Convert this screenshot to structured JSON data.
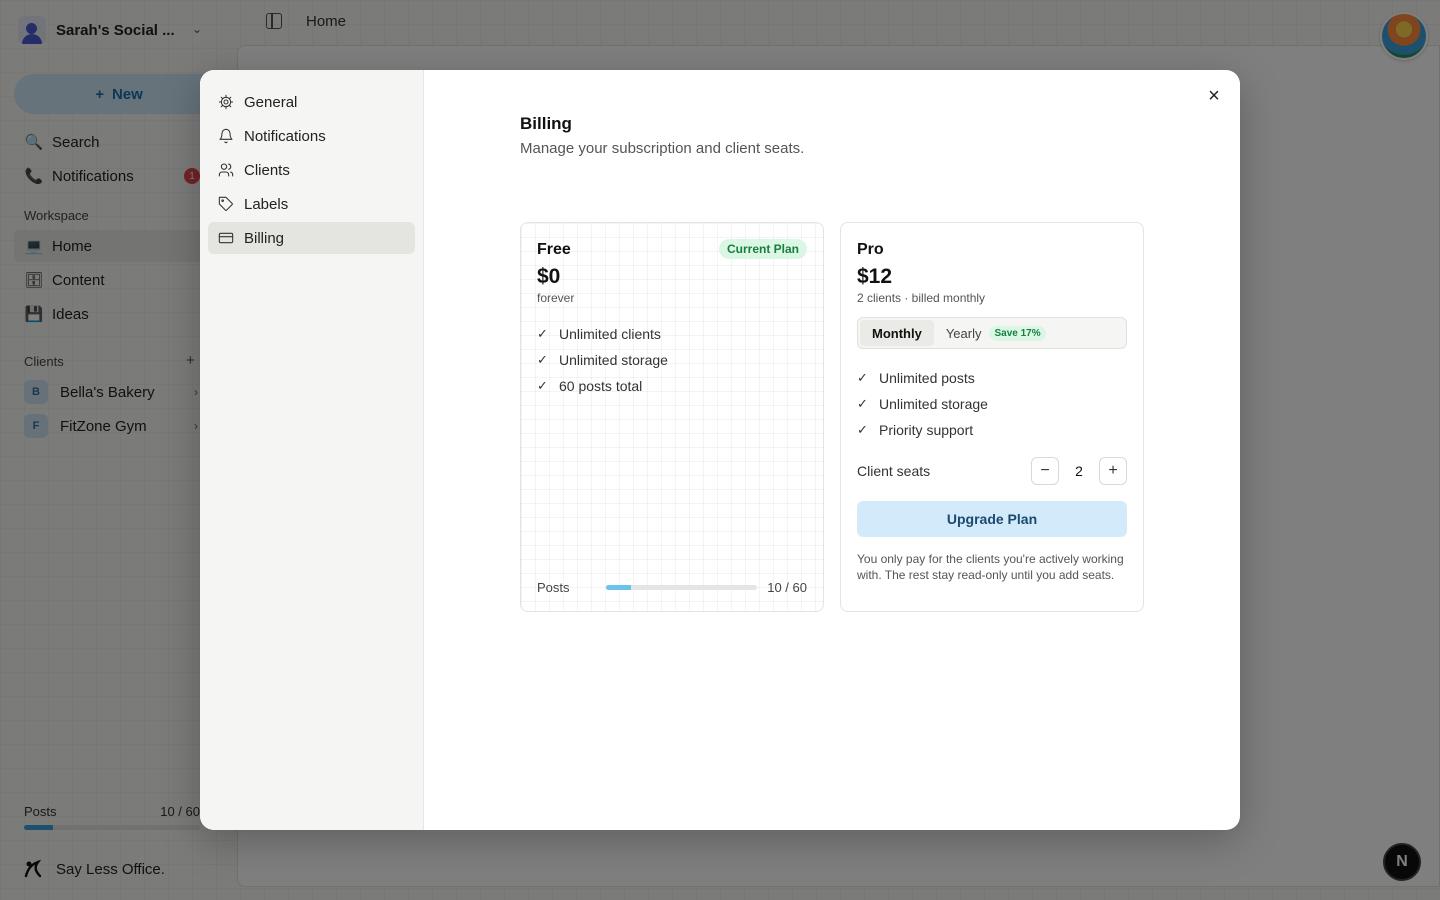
{
  "app": {
    "workspace_name": "Sarah's Social ...",
    "new_label": "New",
    "nav": {
      "search": "Search",
      "notifications": "Notifications",
      "notifications_count": "1",
      "workspace_heading": "Workspace",
      "home": "Home",
      "content": "Content",
      "ideas": "Ideas",
      "clients_heading": "Clients"
    },
    "clients": [
      {
        "letter": "B",
        "name": "Bella's Bakery"
      },
      {
        "letter": "F",
        "name": "FitZone Gym"
      }
    ],
    "posts_footer": {
      "label": "Posts",
      "value": "10 / 60",
      "fraction": 0.167
    },
    "brand": "Say Less Office.",
    "topbar_title": "Home",
    "n_badge": "N"
  },
  "modal": {
    "nav": [
      {
        "label": "General",
        "icon": "gear-icon"
      },
      {
        "label": "Notifications",
        "icon": "bell-icon"
      },
      {
        "label": "Clients",
        "icon": "users-icon"
      },
      {
        "label": "Labels",
        "icon": "tag-icon"
      },
      {
        "label": "Billing",
        "icon": "credit-card-icon",
        "active": true
      }
    ],
    "close_label": "×",
    "title": "Billing",
    "subtitle": "Manage your subscription and client seats.",
    "free_plan": {
      "name": "Free",
      "price": "$0",
      "period": "forever",
      "badge": "Current Plan",
      "features": [
        "Unlimited clients",
        "Unlimited storage",
        "60 posts total"
      ],
      "usage_label": "Posts",
      "usage_value": "10 / 60",
      "usage_fraction": 0.167
    },
    "pro_plan": {
      "name": "Pro",
      "price": "$12",
      "period": "2 clients · billed monthly",
      "toggle_monthly": "Monthly",
      "toggle_yearly": "Yearly",
      "save_badge": "Save 17%",
      "features": [
        "Unlimited posts",
        "Unlimited storage",
        "Priority support"
      ],
      "seats_label": "Client seats",
      "seats_value": "2",
      "minus": "−",
      "plus": "+",
      "upgrade_label": "Upgrade Plan",
      "note": "You only pay for the clients you're actively working with. The rest stay read-only until you add seats."
    }
  },
  "colors": {
    "accent_blue": "#3aa0d8",
    "upgrade_bg": "#d3eafb",
    "badge_green_bg": "#dcf6e5",
    "badge_green_text": "#16803c",
    "notif_red": "#e5484d"
  }
}
